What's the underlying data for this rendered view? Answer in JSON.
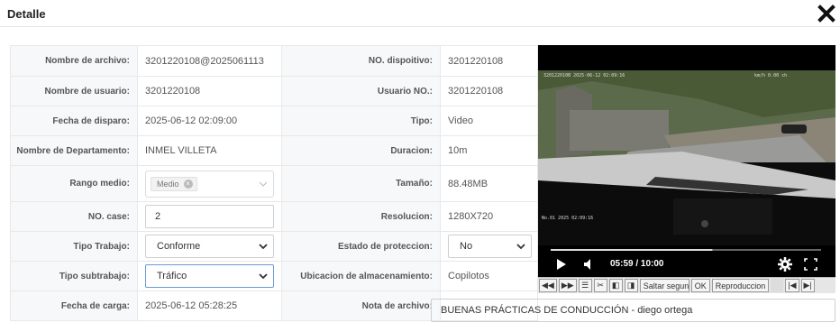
{
  "dialog": {
    "title": "Detalle",
    "close_icon": "close-icon"
  },
  "left": {
    "file_name_label": "Nombre de archivo:",
    "file_name": "3201220108@2025061113",
    "user_name_label": "Nombre de usuario:",
    "user_name": "3201220108",
    "trigger_date_label": "Fecha de disparo:",
    "trigger_date": "2025-06-12 02:09:00",
    "department_label": "Nombre de Departamento:",
    "department": "INMEL VILLETA",
    "range_label": "Rango medio:",
    "range_tag": "Medio",
    "case_label": "NO. case:",
    "case_value": "2",
    "work_type_label": "Tipo Trabajo:",
    "work_type": "Conforme",
    "work_subtype_label": "Tipo subtrabajo:",
    "work_subtype": "Tráfico",
    "upload_date_label": "Fecha de carga:",
    "upload_date": "2025-06-12 05:28:25"
  },
  "right": {
    "device_label": "NO. dispoitivo:",
    "device": "3201220108",
    "user_no_label": "Usuario NO.:",
    "user_no": "3201220108",
    "type_label": "Tipo:",
    "type": "Video",
    "duration_label": "Duracion:",
    "duration": "10m",
    "size_label": "Tamaño:",
    "size": "88.48MB",
    "resolution_label": "Resolucion:",
    "resolution": "1280X720",
    "protection_label": "Estado de proteccion:",
    "protection": "No",
    "storage_label": "Ubicacion de almacenamiento:",
    "storage": "Copilotos",
    "note_label": "Nota de archivo:",
    "note": "BUENAS PRÁCTICAS DE CONDUCCIÓN - diego ortega"
  },
  "player": {
    "time": "05:59 / 10:00",
    "progress": 0.598,
    "skip_placeholder": "Saltar segundo",
    "ok_label": "OK",
    "playback_label": "Reproduccion"
  }
}
